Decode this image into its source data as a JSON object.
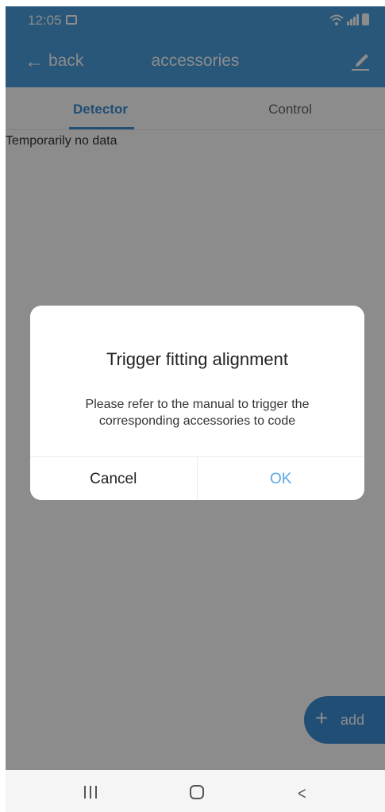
{
  "status_bar": {
    "time": "12:05",
    "icons": [
      "image-icon",
      "wifi-icon",
      "signal-icon",
      "battery-icon"
    ]
  },
  "header": {
    "back_label": "back",
    "title": "accessories",
    "back_icon": "arrow-left-icon",
    "edit_icon": "pencil-edit-icon"
  },
  "tabs": [
    {
      "label": "Detector",
      "active": true
    },
    {
      "label": "Control",
      "active": false
    }
  ],
  "content": {
    "empty_text": "Temporarily no data"
  },
  "fab": {
    "icon": "plus",
    "label": "add"
  },
  "dialog": {
    "title": "Trigger fitting alignment",
    "message": "Please refer to the manual to trigger the corresponding accessories to code",
    "cancel_label": "Cancel",
    "ok_label": "OK"
  },
  "nav_bar": {
    "icons": [
      "recent-apps-icon",
      "home-icon",
      "back-icon"
    ]
  },
  "colors": {
    "primary": "#4a9fde",
    "accent": "#3b8fd6",
    "ok_text": "#5aa7e6"
  }
}
